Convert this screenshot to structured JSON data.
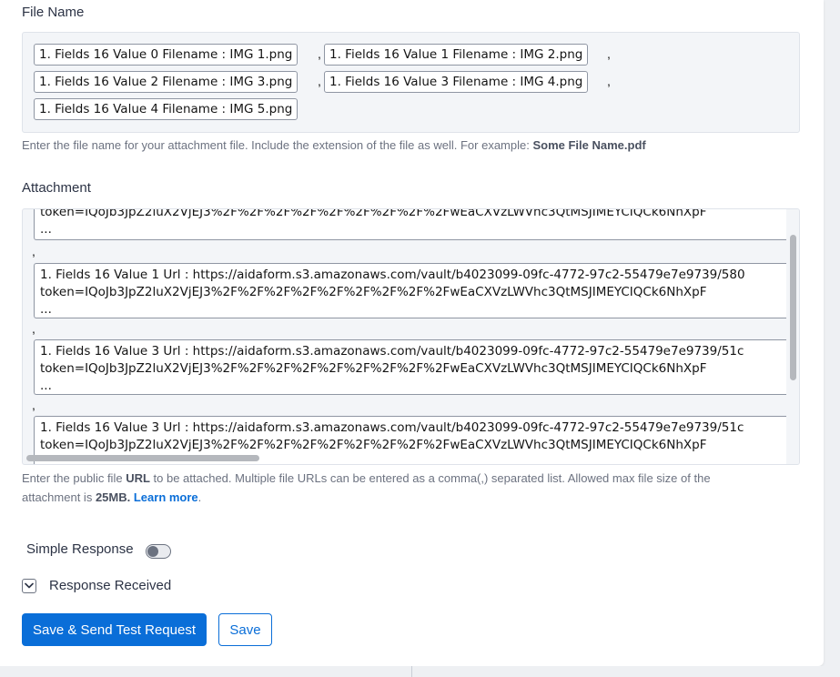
{
  "file_name": {
    "label": "File Name",
    "chips": [
      "1. Fields 16 Value 0 Filename : IMG 1.png",
      "1. Fields 16 Value 1 Filename : IMG 2.png",
      "1. Fields 16 Value 2 Filename : IMG 3.png",
      "1. Fields 16 Value 3 Filename : IMG 4.png",
      "1. Fields 16 Value 4 Filename : IMG 5.png"
    ],
    "separator": ",",
    "help_text": "Enter the file name for your attachment file. Include the extension of the file as well. For example: ",
    "help_example": "Some File Name.pdf"
  },
  "attachment": {
    "label": "Attachment",
    "separator": ",",
    "items": [
      {
        "line1": "",
        "line2": "token=IQoJb3JpZ2luX2VjEJ3%2F%2F%2F%2F%2F%2F%2F%2F%2FwEaCXVzLWVhc3QtMSJIMEYCIQCk6NhXpF",
        "line3": "..."
      },
      {
        "line1": "1. Fields 16 Value 1 Url : https://aidaform.s3.amazonaws.com/vault/b4023099-09fc-4772-97c2-55479e7e9739/580",
        "line2": "token=IQoJb3JpZ2luX2VjEJ3%2F%2F%2F%2F%2F%2F%2F%2F%2FwEaCXVzLWVhc3QtMSJIMEYCIQCk6NhXpF",
        "line3": "..."
      },
      {
        "line1": "1. Fields 16 Value 3 Url : https://aidaform.s3.amazonaws.com/vault/b4023099-09fc-4772-97c2-55479e7e9739/51c",
        "line2": "token=IQoJb3JpZ2luX2VjEJ3%2F%2F%2F%2F%2F%2F%2F%2F%2FwEaCXVzLWVhc3QtMSJIMEYCIQCk6NhXpF",
        "line3": "..."
      },
      {
        "line1": "1. Fields 16 Value 3 Url : https://aidaform.s3.amazonaws.com/vault/b4023099-09fc-4772-97c2-55479e7e9739/51c",
        "line2": "token=IQoJb3JpZ2luX2VjEJ3%2F%2F%2F%2F%2F%2F%2F%2F%2FwEaCXVzLWVhc3QtMSJIMEYCIQCk6NhXpF",
        "line3": ""
      }
    ],
    "help_part1": "Enter the public file ",
    "help_url": "URL",
    "help_part2": " to be attached. Multiple file URLs can be entered as a comma(,) separated list. Allowed max file size of the",
    "help_part3": "attachment is ",
    "help_size": "25MB.",
    "help_link": "Learn more",
    "help_end": "."
  },
  "simple_response": {
    "label": "Simple Response",
    "enabled": false
  },
  "response_received": {
    "label": "Response Received",
    "checked": true
  },
  "buttons": {
    "save_send": "Save & Send Test Request",
    "save": "Save"
  },
  "colors": {
    "accent": "#0a6ed8",
    "text": "#2c3345",
    "muted": "#6c7280"
  },
  "icons": {
    "check": "checkmark-icon"
  }
}
